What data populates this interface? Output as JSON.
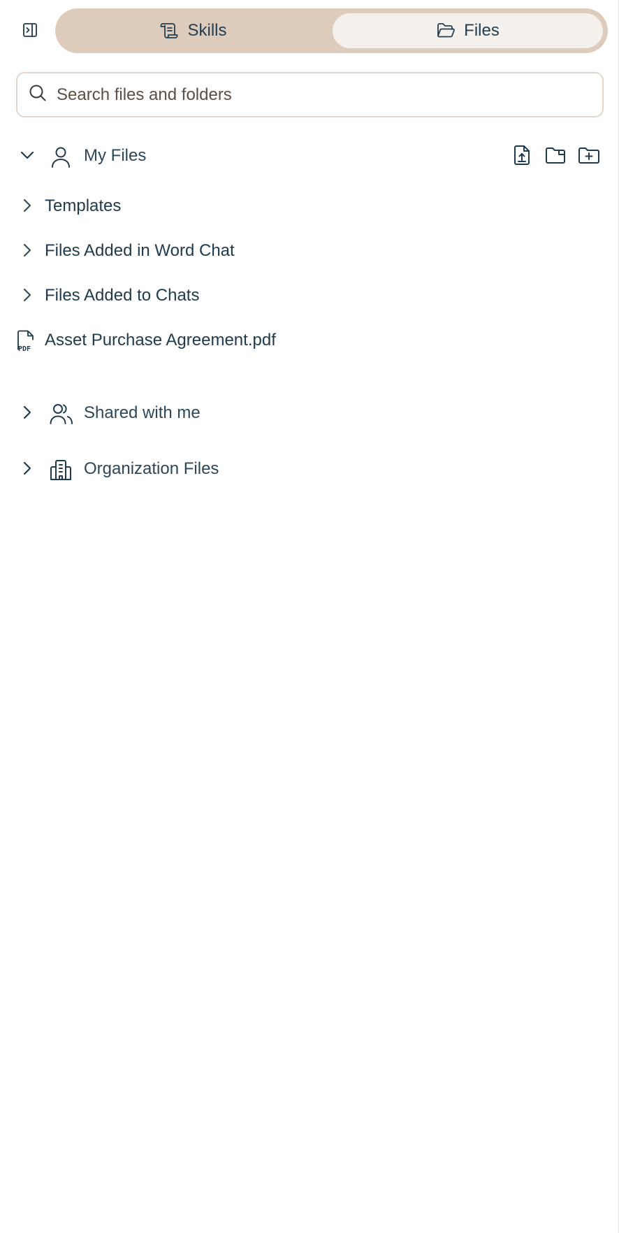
{
  "tabs": {
    "skills_label": "Skills",
    "files_label": "Files",
    "active": "Files"
  },
  "search": {
    "placeholder": "Search files and folders",
    "value": ""
  },
  "my_files": {
    "label": "My Files",
    "expanded": true,
    "actions": [
      "upload-file-icon",
      "folder-new-file-icon",
      "folder-plus-icon"
    ],
    "items": [
      {
        "type": "folder",
        "label": "Templates",
        "expanded": false
      },
      {
        "type": "folder",
        "label": "Files Added in Word Chat",
        "expanded": false
      },
      {
        "type": "folder",
        "label": "Files Added to Chats",
        "expanded": false
      },
      {
        "type": "file",
        "label": "Asset Purchase Agreement.pdf",
        "icon": "pdf-file-icon"
      }
    ]
  },
  "shared": {
    "label": "Shared with me",
    "expanded": false
  },
  "organization": {
    "label": "Organization Files",
    "expanded": false
  },
  "colors": {
    "tabbar": "#ddcbbc",
    "active_tab": "#f4f1ed",
    "text": "#1f3a4d",
    "search_border": "#e0d6cc"
  }
}
